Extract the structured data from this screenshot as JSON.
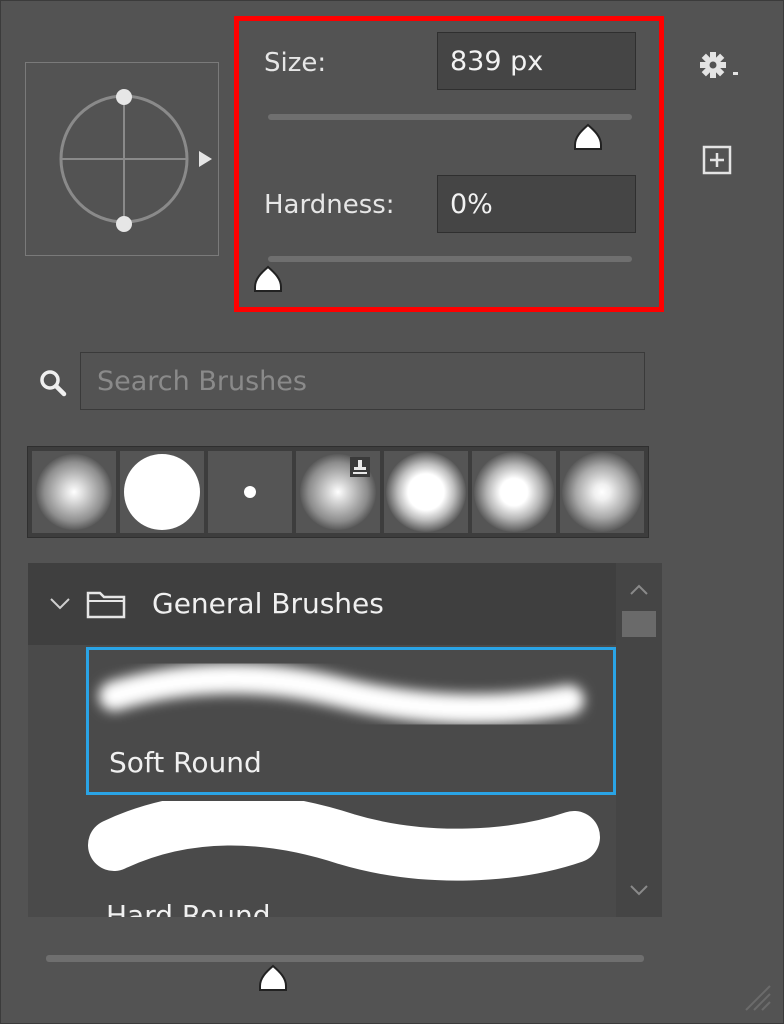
{
  "brush_settings": {
    "size_label": "Size:",
    "size_value": "839 px",
    "size_slider_fraction": 0.88,
    "hardness_label": "Hardness:",
    "hardness_value": "0%",
    "hardness_slider_fraction": 0.0
  },
  "toolbar": {
    "settings_icon": "gear-icon",
    "new_preset_icon": "plus-square-icon"
  },
  "search": {
    "placeholder": "Search Brushes",
    "value": ""
  },
  "recent_brushes": [
    {
      "name": "soft-round-large",
      "hardness": "soft"
    },
    {
      "name": "hard-round-large",
      "hardness": "hard"
    },
    {
      "name": "small-dot",
      "hardness": "hard"
    },
    {
      "name": "soft-round-badge",
      "hardness": "soft"
    },
    {
      "name": "glow-round-1",
      "hardness": "medium"
    },
    {
      "name": "glow-round-2",
      "hardness": "medium"
    },
    {
      "name": "glow-round-3",
      "hardness": "soft"
    }
  ],
  "brush_list": {
    "group": {
      "title": "General Brushes",
      "expanded": true,
      "items": [
        {
          "name": "Soft Round",
          "selected": true
        },
        {
          "name": "Hard Round",
          "selected": false
        }
      ]
    }
  },
  "preview_slider_fraction": 0.38,
  "colors": {
    "accent": "#2aa4e6",
    "highlight": "#ff0000",
    "panel_bg": "#535353"
  }
}
